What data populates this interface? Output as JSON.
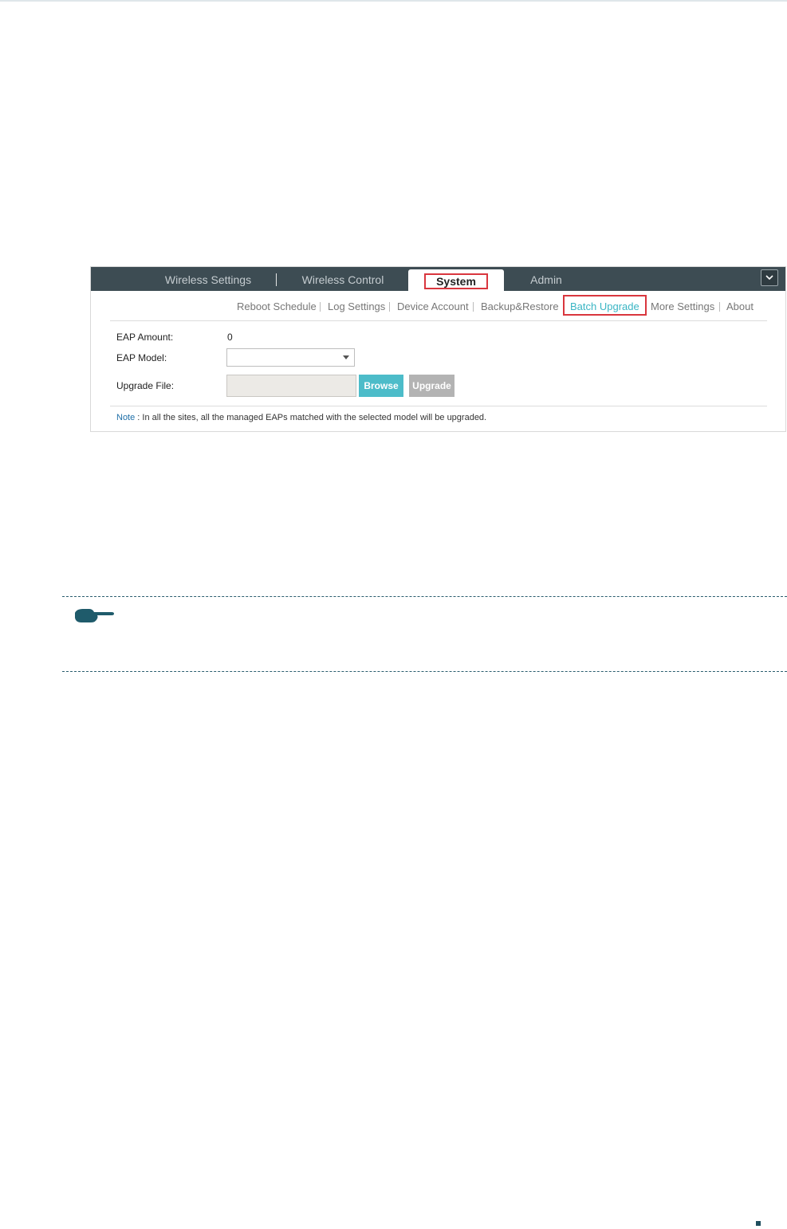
{
  "tabs": {
    "items": [
      "Wireless Settings",
      "Wireless Control",
      "System",
      "Admin"
    ],
    "active": "System"
  },
  "subnav": {
    "items": [
      "Reboot Schedule",
      "Log Settings",
      "Device Account",
      "Backup&Restore",
      "Batch Upgrade",
      "More Settings",
      "About"
    ],
    "active": "Batch Upgrade"
  },
  "form": {
    "eap_amount_label": "EAP Amount:",
    "eap_amount_value": "0",
    "eap_model_label": "EAP Model:",
    "eap_model_value": "",
    "upgrade_file_label": "Upgrade File:",
    "upgrade_file_value": "",
    "browse_label": "Browse",
    "upgrade_label": "Upgrade"
  },
  "note": {
    "keyword": "Note",
    "text": " : In all the sites, all the managed EAPs matched with the selected model will be upgraded."
  },
  "colors": {
    "tabbar": "#3d4c53",
    "accent": "#4cbcc9",
    "highlight": "#d9363e",
    "disabled": "#b3b3b3",
    "note_icon": "#1f5b6b"
  },
  "icons": {
    "collapse": "chevron-down-icon",
    "note": "pointing-hand-icon",
    "dropdown": "caret-down-icon"
  }
}
